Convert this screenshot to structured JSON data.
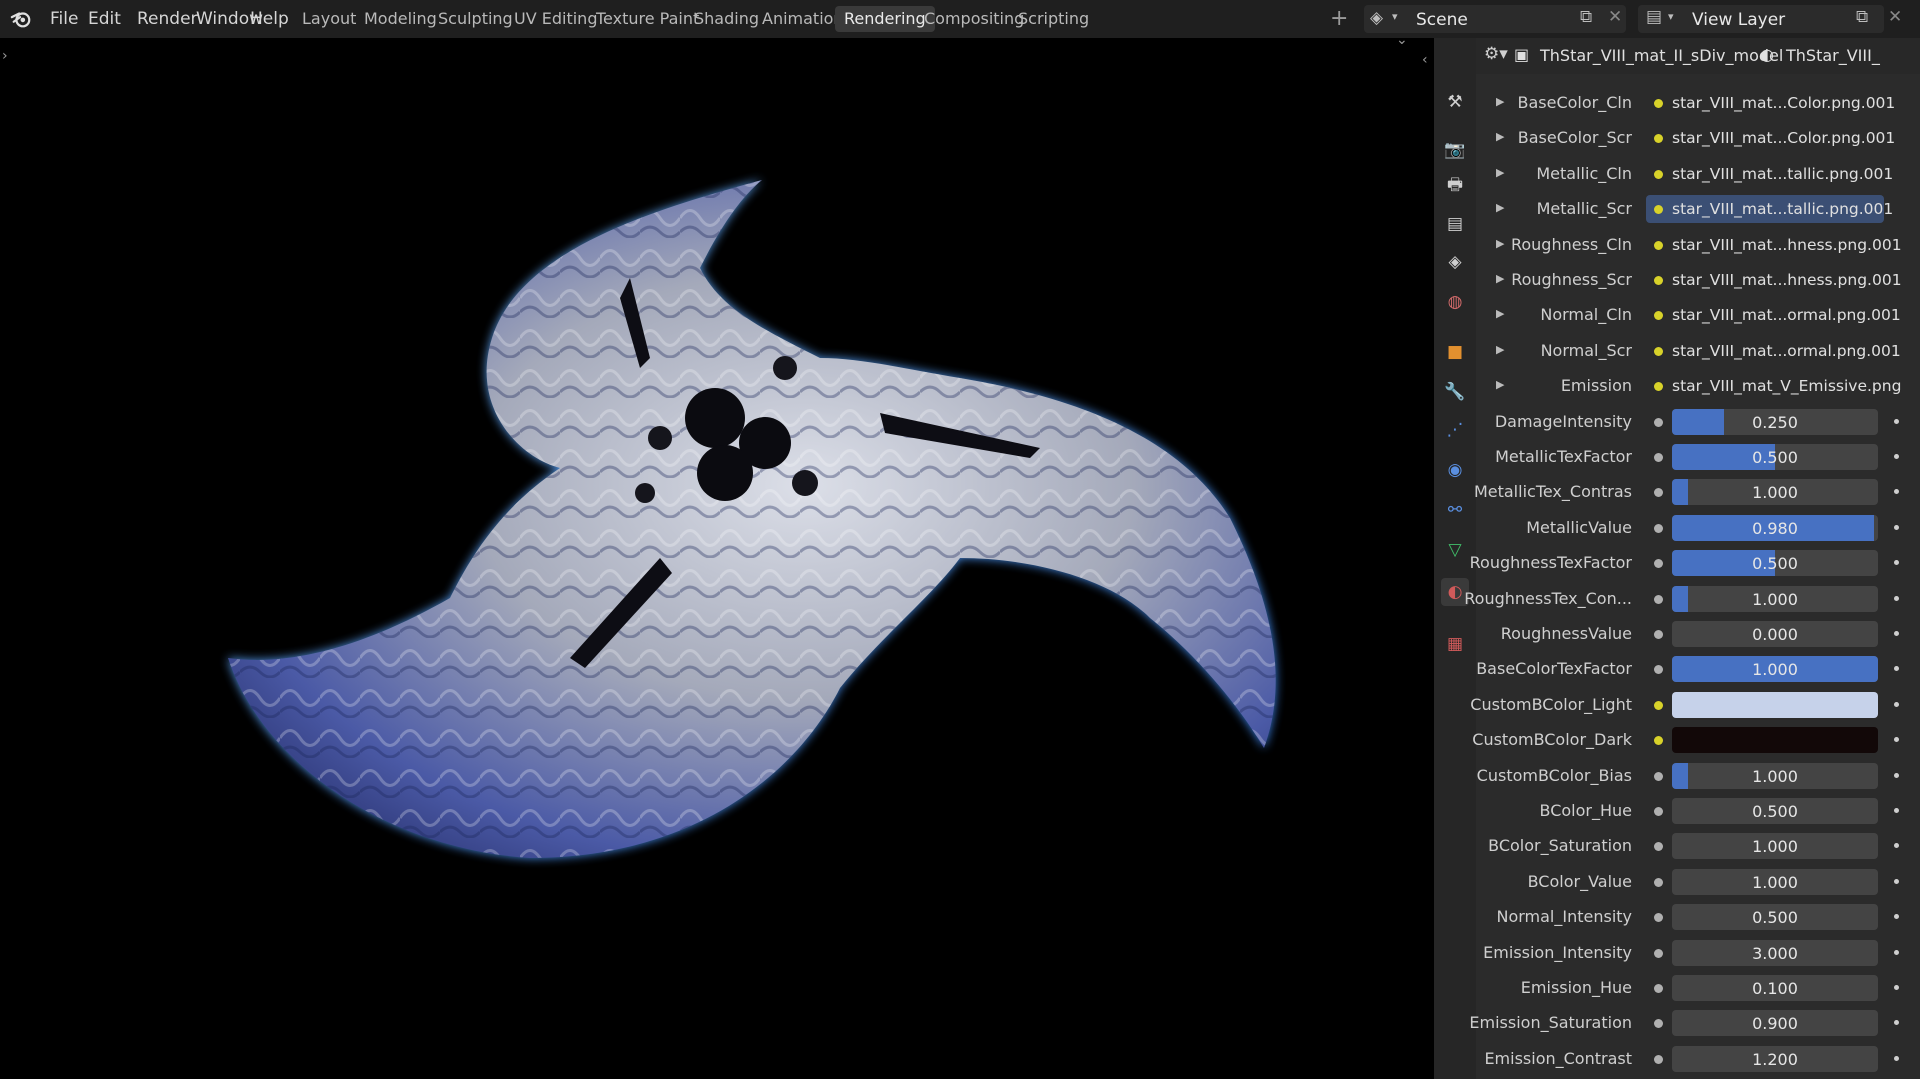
{
  "menu": [
    "File",
    "Edit",
    "Render",
    "Window",
    "Help"
  ],
  "workspaces": [
    {
      "label": "Layout",
      "active": false
    },
    {
      "label": "Modeling",
      "active": false
    },
    {
      "label": "Sculpting",
      "active": false
    },
    {
      "label": "UV Editing",
      "active": false
    },
    {
      "label": "Texture Paint",
      "active": false
    },
    {
      "label": "Shading",
      "active": false
    },
    {
      "label": "Animation",
      "active": false
    },
    {
      "label": "Rendering",
      "active": true
    },
    {
      "label": "Compositing",
      "active": false
    },
    {
      "label": "Scripting",
      "active": false
    }
  ],
  "scene_name": "Scene",
  "view_layer": "View Layer",
  "breadcrumb": {
    "object": "ThStar_VIII_mat_II_sDiv_model",
    "material": "ThStar_VIII_"
  },
  "colors": {
    "accent": "#4771c2",
    "selected": "#3b4f74",
    "socket_yellow": "#d8d22a"
  },
  "texture_inputs": [
    {
      "label": "BaseColor_Cln",
      "file": "star_VIII_mat...Color.png.001",
      "selected": false
    },
    {
      "label": "BaseColor_Scr",
      "file": "star_VIII_mat...Color.png.001",
      "selected": false
    },
    {
      "label": "Metallic_Cln",
      "file": "star_VIII_mat...tallic.png.001",
      "selected": false
    },
    {
      "label": "Metallic_Scr",
      "file": "star_VIII_mat...tallic.png.001",
      "selected": true
    },
    {
      "label": "Roughness_Cln",
      "file": "star_VIII_mat...hness.png.001",
      "selected": false
    },
    {
      "label": "Roughness_Scr",
      "file": "star_VIII_mat...hness.png.001",
      "selected": false
    },
    {
      "label": "Normal_Cln",
      "file": "star_VIII_mat...ormal.png.001",
      "selected": false
    },
    {
      "label": "Normal_Scr",
      "file": "star_VIII_mat...ormal.png.001",
      "selected": false
    },
    {
      "label": "Emission",
      "file": "star_VIII_mat_V_Emissive.png",
      "selected": false
    }
  ],
  "value_inputs": [
    {
      "label": "DamageIntensity",
      "value": "0.250",
      "fill": 0.25
    },
    {
      "label": "MetallicTexFactor",
      "value": "0.500",
      "fill": 0.5
    },
    {
      "label": "MetallicTex_Contras",
      "value": "1.000",
      "fill": 0.08
    },
    {
      "label": "MetallicValue",
      "value": "0.980",
      "fill": 0.98
    },
    {
      "label": "RoughnessTexFactor",
      "value": "0.500",
      "fill": 0.5
    },
    {
      "label": "RoughnessTex_Con...",
      "value": "1.000",
      "fill": 0.08
    },
    {
      "label": "RoughnessValue",
      "value": "0.000",
      "fill": 0
    },
    {
      "label": "BaseColorTexFactor",
      "value": "1.000",
      "fill": 1.0
    },
    {
      "label": "CustomBColor_Light",
      "color": "#c6d2ea"
    },
    {
      "label": "CustomBColor_Dark",
      "color": "#120808"
    },
    {
      "label": "CustomBColor_Bias",
      "value": "1.000",
      "fill": 0.08
    },
    {
      "label": "BColor_Hue",
      "value": "0.500",
      "fill": 0
    },
    {
      "label": "BColor_Saturation",
      "value": "1.000",
      "fill": 0
    },
    {
      "label": "BColor_Value",
      "value": "1.000",
      "fill": 0
    },
    {
      "label": "Normal_Intensity",
      "value": "0.500",
      "fill": 0
    },
    {
      "label": "Emission_Intensity",
      "value": "3.000",
      "fill": 0
    },
    {
      "label": "Emission_Hue",
      "value": "0.100",
      "fill": 0
    },
    {
      "label": "Emission_Saturation",
      "value": "0.900",
      "fill": 0
    },
    {
      "label": "Emission_Contrast",
      "value": "1.200",
      "fill": 0
    }
  ],
  "property_tabs": [
    "tool-icon",
    "render-icon",
    "output-icon",
    "view-layer-icon",
    "scene-icon",
    "world-icon",
    "object-icon",
    "modifier-icon",
    "particles-icon",
    "physics-icon",
    "constraints-icon",
    "object-data-icon",
    "material-icon",
    "texture-icon"
  ]
}
